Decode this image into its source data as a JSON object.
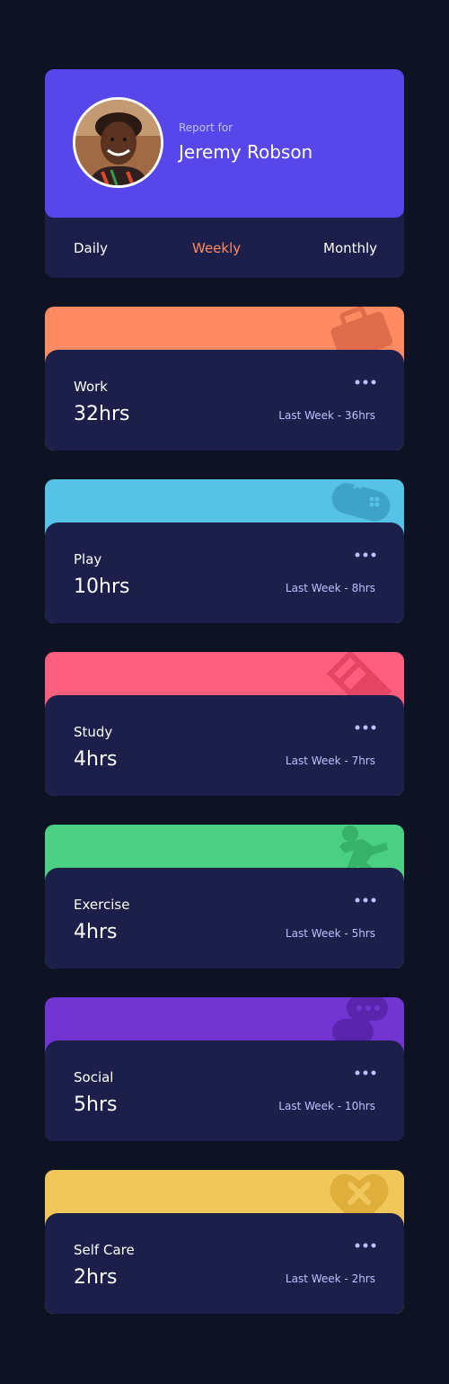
{
  "profile": {
    "report_label": "Report for",
    "name": "Jeremy Robson"
  },
  "periods": [
    {
      "label": "Daily",
      "active": false
    },
    {
      "label": "Weekly",
      "active": true
    },
    {
      "label": "Monthly",
      "active": false
    }
  ],
  "activities": [
    {
      "title": "Work",
      "hours": "32hrs",
      "previous": "Last Week - 36hrs",
      "color": "#ff8b64",
      "icon": "briefcase-icon"
    },
    {
      "title": "Play",
      "hours": "10hrs",
      "previous": "Last Week - 8hrs",
      "color": "#55c2e6",
      "icon": "gamepad-icon"
    },
    {
      "title": "Study",
      "hours": "4hrs",
      "previous": "Last Week - 7hrs",
      "color": "#ff5e7d",
      "icon": "books-icon"
    },
    {
      "title": "Exercise",
      "hours": "4hrs",
      "previous": "Last Week - 5hrs",
      "color": "#4bcf82",
      "icon": "running-icon"
    },
    {
      "title": "Social",
      "hours": "5hrs",
      "previous": "Last Week - 10hrs",
      "color": "#7335d2",
      "icon": "speech-bubbles-icon"
    },
    {
      "title": "Self Care",
      "hours": "2hrs",
      "previous": "Last Week - 2hrs",
      "color": "#f1c75b",
      "icon": "heart-bandage-icon"
    }
  ],
  "colors": {
    "page_background": "#0e1323",
    "card_background": "#1c1f4a",
    "profile_accent": "#5747ea",
    "active_tab": "#ff8b64",
    "muted_text": "#bdc1ff"
  }
}
